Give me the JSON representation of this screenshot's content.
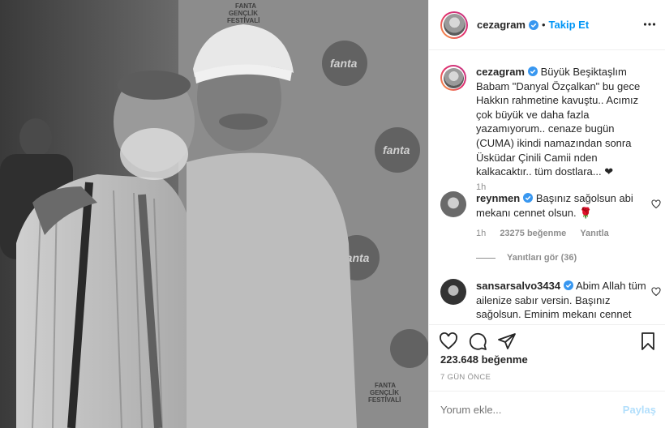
{
  "header": {
    "username": "cezagram",
    "separator": "•",
    "follow_label": "Takip Et"
  },
  "caption": {
    "username": "cezagram",
    "text": "Büyük Beşiktaşlım Babam \"Danyal Özçalkan\" bu gece Hakkın rahmetine kavuştu.. Acımız çok büyük ve daha fazla yazamıyorum.. cenaze bugün (CUMA) ikindi namazından sonra Üsküdar Çinili Camii nden kalkacaktır.. tüm dostlara... ❤",
    "time": "1h"
  },
  "comments": [
    {
      "username": "reynmen",
      "text": "Başınız sağolsun abi mekanı cennet olsun. 🌹",
      "time": "1h",
      "likes": "23275 beğenme",
      "reply_label": "Yanıtla",
      "view_replies": "Yanıtları gör (36)"
    },
    {
      "username": "sansarsalvo3434",
      "text": "Abim Allah tüm ailenize sabır versin. Başınız sağolsun. Eminim mekanı cennet"
    }
  ],
  "likes_count": "223.648 beğenme",
  "post_date": "7 GÜN ÖNCE",
  "add_comment": {
    "placeholder": "Yorum ekle...",
    "post_label": "Paylaş"
  },
  "photo": {
    "watermark_text": "fanta",
    "festival_text_1": "FANTA",
    "festival_text_2": "GENÇLİK",
    "festival_text_3": "FESTİVALİ"
  },
  "colors": {
    "link_blue": "#0095f6",
    "muted": "#8e8e8e",
    "text": "#262626",
    "post_disabled": "#b2dffc"
  },
  "icons": [
    "verified-badge-icon",
    "more-options-icon",
    "heart-icon",
    "comment-icon",
    "share-icon",
    "bookmark-icon",
    "small-heart-icon"
  ]
}
